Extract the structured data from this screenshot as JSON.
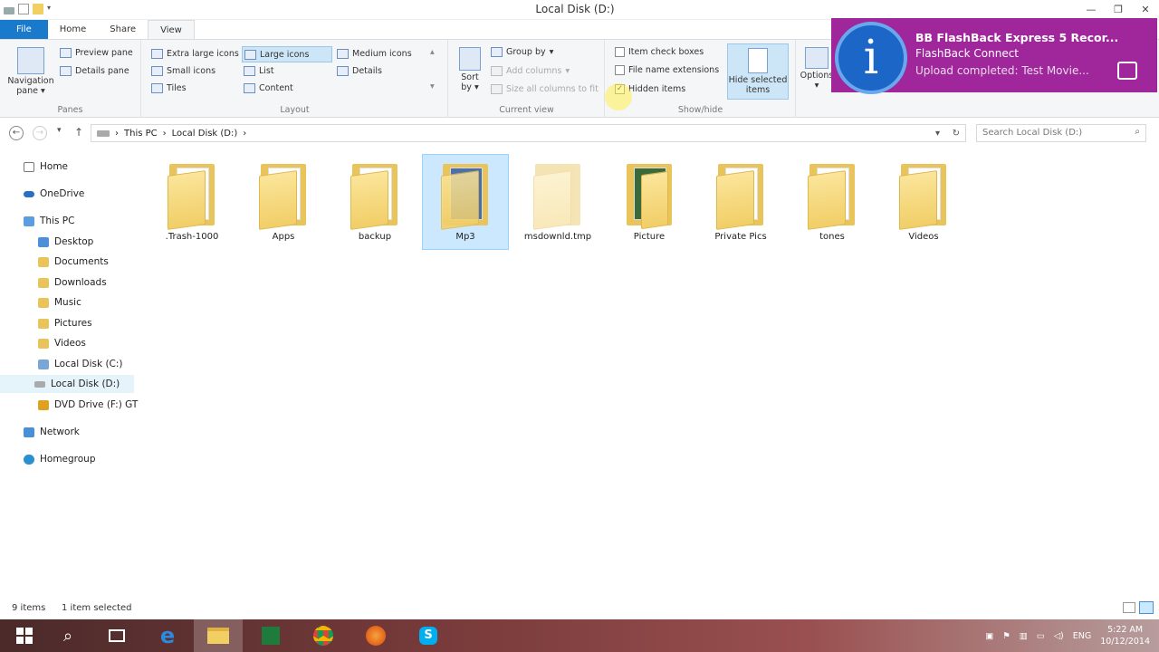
{
  "window": {
    "title": "Local Disk (D:)"
  },
  "tabs": [
    {
      "label": "File"
    },
    {
      "label": "Home"
    },
    {
      "label": "Share"
    },
    {
      "label": "View"
    }
  ],
  "ribbon": {
    "panes": {
      "label": "Panes",
      "nav_pane": "Navigation pane",
      "preview_pane": "Preview pane",
      "details_pane": "Details pane"
    },
    "layout": {
      "label": "Layout",
      "items": [
        "Extra large icons",
        "Large icons",
        "Medium icons",
        "Small icons",
        "List",
        "Details",
        "Tiles",
        "Content"
      ],
      "selected": "Large icons"
    },
    "current_view": {
      "label": "Current view",
      "sort_by": "Sort by",
      "group_by": "Group by",
      "add_columns": "Add columns",
      "size_columns": "Size all columns to fit"
    },
    "show_hide": {
      "label": "Show/hide",
      "item_check_boxes": "Item check boxes",
      "file_name_extensions": "File name extensions",
      "hidden_items": "Hidden items",
      "hide_selected": "Hide selected items",
      "options": "Options"
    },
    "checks": {
      "item_check_boxes": "",
      "file_name_extensions": "",
      "hidden_items": "✓"
    }
  },
  "address": {
    "crumb_1": "This PC",
    "crumb_2": "Local Disk (D:)",
    "search_placeholder": "Search Local Disk (D:)"
  },
  "sidebar": {
    "items": [
      {
        "label": "Home"
      },
      {
        "label": "OneDrive"
      },
      {
        "label": "This PC"
      },
      {
        "label": "Desktop"
      },
      {
        "label": "Documents"
      },
      {
        "label": "Downloads"
      },
      {
        "label": "Music"
      },
      {
        "label": "Pictures"
      },
      {
        "label": "Videos"
      },
      {
        "label": "Local Disk (C:)"
      },
      {
        "label": "Local Disk (D:)"
      },
      {
        "label": "DVD Drive (F:) GT"
      },
      {
        "label": "Network"
      },
      {
        "label": "Homegroup"
      }
    ]
  },
  "folders": [
    {
      "label": ".Trash-1000"
    },
    {
      "label": "Apps"
    },
    {
      "label": "backup"
    },
    {
      "label": "Mp3"
    },
    {
      "label": "msdownld.tmp"
    },
    {
      "label": "Picture"
    },
    {
      "label": "Private Pics"
    },
    {
      "label": "tones"
    },
    {
      "label": "Videos"
    }
  ],
  "status": {
    "count": "9 items",
    "selection": "1 item selected"
  },
  "toast": {
    "title": "BB FlashBack Express 5 Recor...",
    "subtitle": "FlashBack Connect",
    "message": "Upload completed: Test Movie..."
  },
  "tray": {
    "lang": "ENG",
    "time": "5:22 AM",
    "date": "10/12/2014"
  },
  "colors": {
    "file_tab": "#1979ca",
    "toast_bg": "#a0269c",
    "toast_icon": "#1c66c7"
  }
}
